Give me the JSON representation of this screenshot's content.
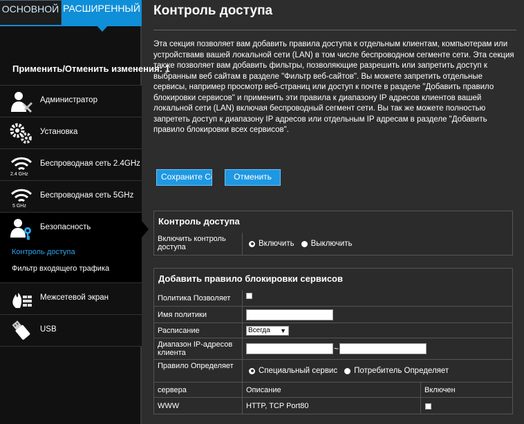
{
  "tabs": {
    "basic": "ОСНОВНОЙ",
    "advanced": "РАСШИРЕННЫЙ"
  },
  "apply_label": "Применить/Отменить изменения: 1",
  "menu": {
    "admin": "Администратор",
    "setup": "Установка",
    "wifi24": "Беспроводная сеть 2.4GHz",
    "wifi24_sub": "2.4 GHz",
    "wifi5": "Беспроводная сеть 5GHz",
    "wifi5_sub": "5 GHz",
    "security": "Безопасность",
    "security_sub_access": "Контроль доступа",
    "security_sub_filter": "Фильтр входящего трафика",
    "firewall": "Межсетевой экран",
    "usb": "USB"
  },
  "page": {
    "title": "Контроль доступа",
    "description": "Эта секция позволяет вам добавить правила доступа к отдельным клиентам, компьютерам или устройствамв вашей локальной сети (LAN) в том числе беспроводном сегменте сети. Эта секция также позволяет вам добавить фильтры, позволяющие разрешить или запретить доступ к выбранным веб сайтам в разделе \"Фильтр веб-сайтов\". Вы можете запретить отдельные сервисы, например просмотр веб-страниц или доступ к почте в разделе \"Добавить правило блокировки сервисов\" и применить эти правила к диапазону IP адресов клиентов вашей локальной сети (LAN) включая беспроводный сегмент сети. Вы так же можете полностью запрететь доступ к диапазону IP адресов или отдельным IP адресам в разделе \"Добавить правило блокировки всех сервисов\".",
    "save_button": "Сохраните Сохраните",
    "cancel_button": "Отменить"
  },
  "access_panel": {
    "heading": "Контроль доступа",
    "enable_label": "Включить контроль доступа",
    "opt_on": "Включить",
    "opt_off": "Выключить"
  },
  "rule_panel": {
    "heading": "Добавить правило блокировки сервисов",
    "policy_allow_label": "Политика Позволяет",
    "policy_name_label": "Имя политики",
    "policy_name_value": "",
    "schedule_label": "Расписание",
    "schedule_value": "Всегда",
    "ip_range_label": "Диапазон IP-адресов клиента",
    "ip_from_value": "",
    "ip_to_value": "",
    "tilde": "~",
    "rule_defines_label": "Правило Определяет",
    "opt_special": "Специальный сервис",
    "opt_user": "Потребитель Определяет",
    "col_server": "сервера",
    "col_desc": "Описание",
    "col_enabled": "Включен",
    "rows": [
      {
        "server": "WWW",
        "desc": "HTTP, TCP Port80"
      }
    ]
  }
}
